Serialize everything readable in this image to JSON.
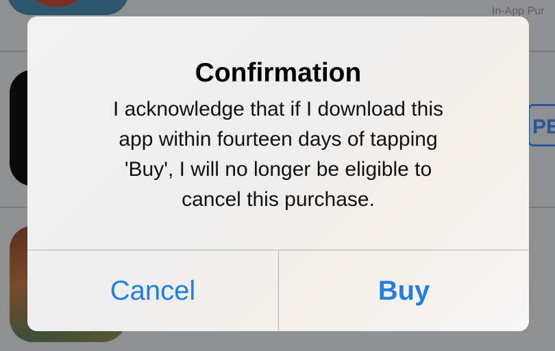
{
  "background": {
    "in_app_label": "In-App Pur",
    "action_button_label": "PE"
  },
  "alert": {
    "title": "Confirmation",
    "message_lines": [
      "I acknowledge that if I download this",
      "app within fourteen days of tapping",
      "'Buy', I will no longer be eligible to",
      "cancel this purchase."
    ],
    "cancel_label": "Cancel",
    "buy_label": "Buy"
  },
  "colors": {
    "accent": "#1f7fe3",
    "dim_overlay": "#8f9092"
  }
}
